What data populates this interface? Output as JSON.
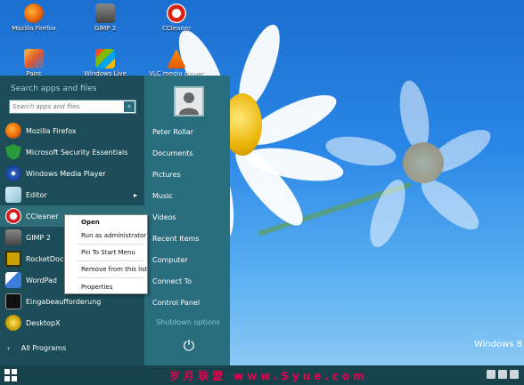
{
  "desktop": {
    "icons": [
      {
        "label": "Mozilla Firefox",
        "icon": "firefox-icon"
      },
      {
        "label": "GIMP 2",
        "icon": "gimp-icon"
      },
      {
        "label": "CCleaner",
        "icon": "ccleaner-icon"
      },
      {
        "label": "Paint",
        "icon": "paint-icon"
      },
      {
        "label": "Windows Live",
        "icon": "windows-live-icon"
      },
      {
        "label": "VLC media player",
        "icon": "vlc-icon"
      }
    ],
    "brand": "Windows 8"
  },
  "start_menu": {
    "search_title": "Search apps and files",
    "search_placeholder": "Search apps and files",
    "apps": [
      {
        "label": "Mozilla Firefox",
        "icon": "firefox-icon",
        "color": "#e66000"
      },
      {
        "label": "Microsoft Security Essentials",
        "icon": "shield-icon",
        "color": "#2a9a3a"
      },
      {
        "label": "Windows Media Player",
        "icon": "media-player-icon",
        "color": "#2d62c0"
      },
      {
        "label": "Editor",
        "icon": "notepad-icon",
        "color": "#8fc2d8"
      },
      {
        "label": "CCleaner",
        "icon": "ccleaner-icon",
        "color": "#d42020"
      },
      {
        "label": "GIMP 2",
        "icon": "gimp-icon",
        "color": "#6a6a6a"
      },
      {
        "label": "RocketDock",
        "icon": "rocketdock-icon",
        "color": "#c8a200"
      },
      {
        "label": "WordPad",
        "icon": "wordpad-icon",
        "color": "#3b7dd8"
      },
      {
        "label": "Eingabeaufforderung",
        "icon": "cmd-icon",
        "color": "#111111"
      },
      {
        "label": "DesktopX",
        "icon": "desktopx-icon",
        "color": "#c9a000"
      }
    ],
    "all_programs": "All Programs",
    "user_name": "Peter Rollar",
    "places": [
      "Documents",
      "Pictures",
      "Music",
      "Videos",
      "Recent Items",
      "Computer",
      "Connect To",
      "Control Panel"
    ],
    "shutdown_label": "Shutdown options"
  },
  "context_menu": {
    "items": [
      "Open",
      "Run as administrator",
      "Pin To Start Menu",
      "Remove from this list",
      "Properties"
    ]
  },
  "taskbar": {
    "watermark": "岁月联盟 www.Syue.com"
  }
}
